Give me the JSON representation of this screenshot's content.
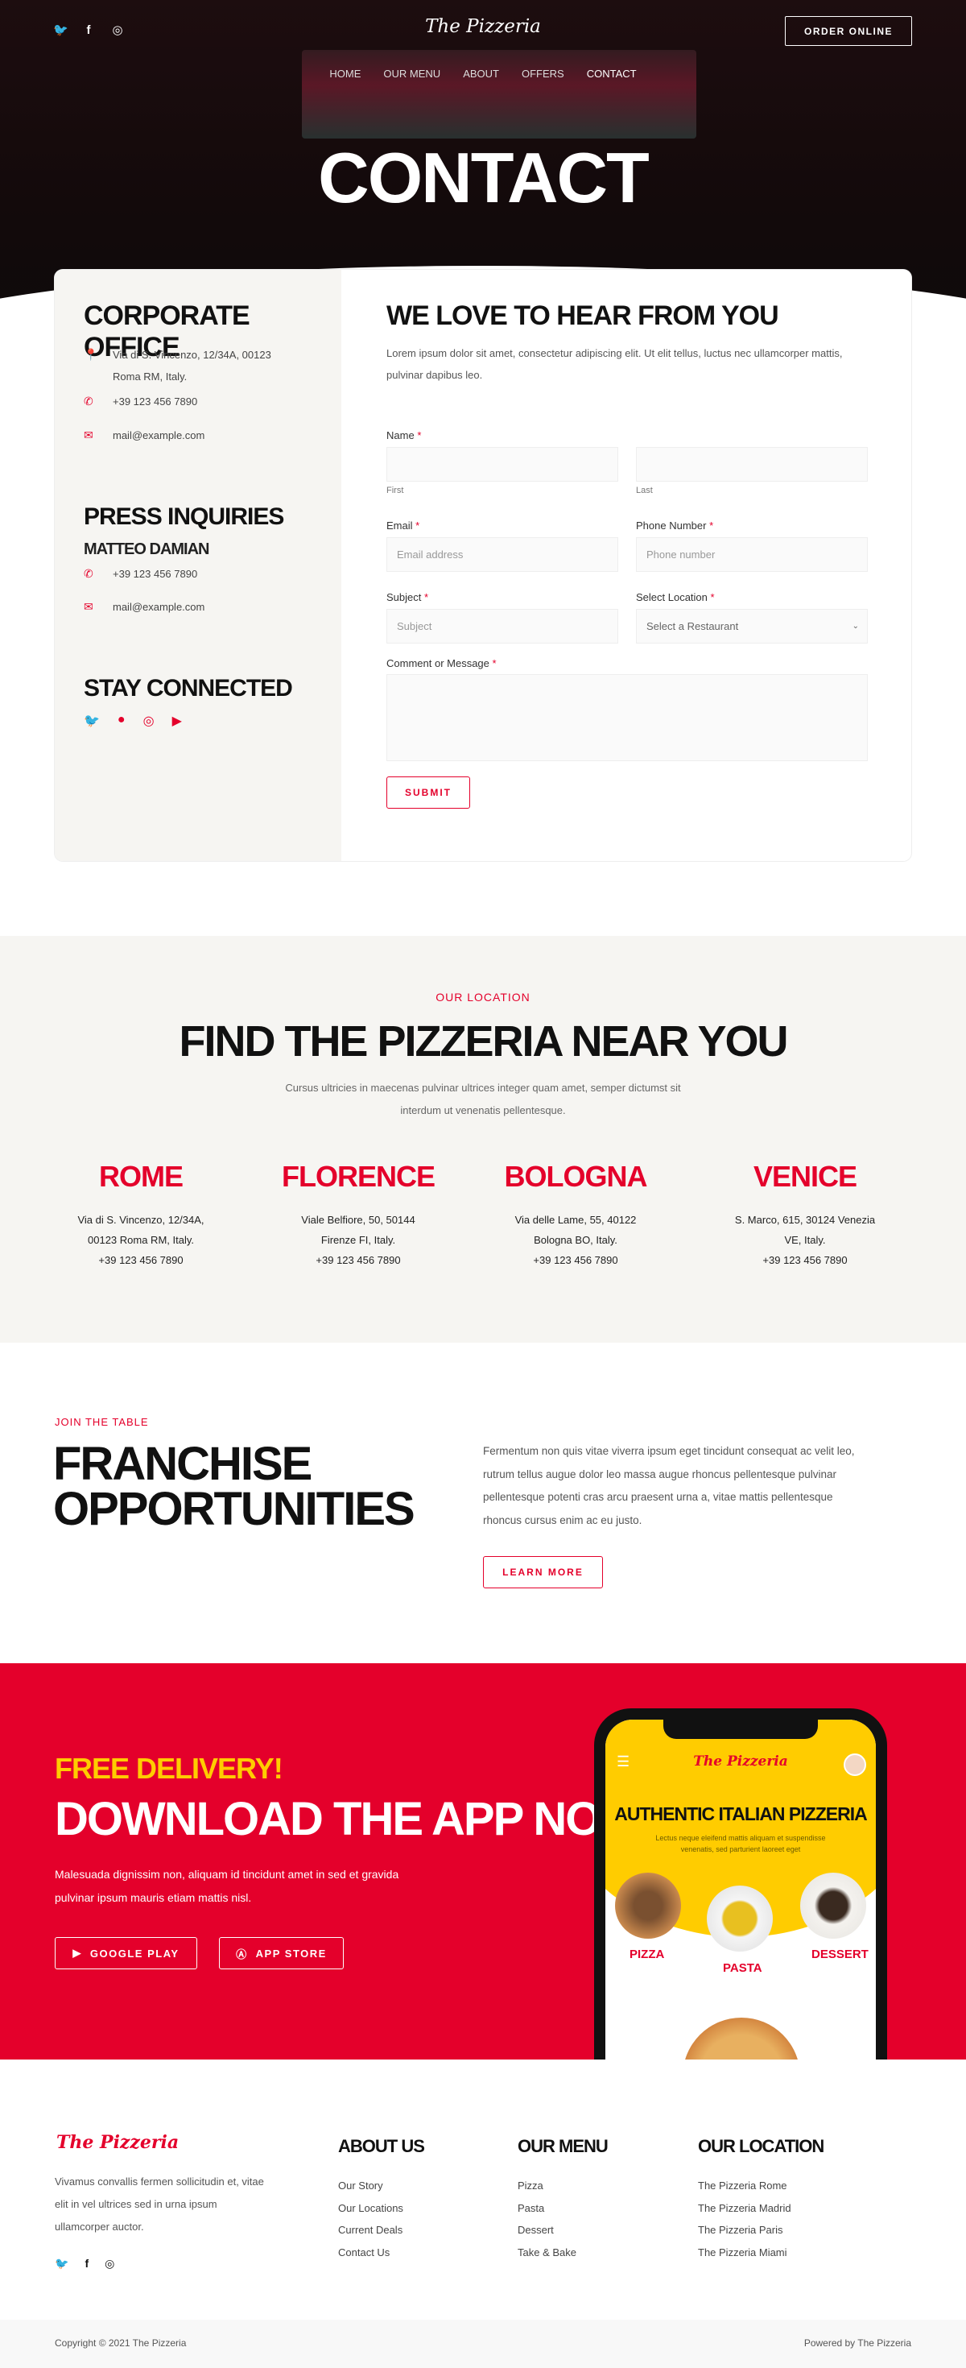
{
  "colors": {
    "accent": "#e4002b",
    "yellow": "#ffcc00",
    "panel": "#f6f5f2"
  },
  "header": {
    "brand": "The Pizzeria",
    "order_button": "ORDER ONLINE",
    "social_icons": [
      "twitter-icon",
      "facebook-icon",
      "instagram-icon"
    ],
    "nav": [
      {
        "label": "HOME",
        "active": false
      },
      {
        "label": "OUR MENU",
        "active": false
      },
      {
        "label": "ABOUT",
        "active": false
      },
      {
        "label": "OFFERS",
        "active": false
      },
      {
        "label": "CONTACT",
        "active": true
      }
    ],
    "title": "CONTACT"
  },
  "contact": {
    "corporate": {
      "title": "CORPORATE OFFICE",
      "address_line1": "Via di S. Vincenzo, 12/34A, 00123",
      "address_line2": "Roma RM, Italy.",
      "phone": "+39 123 456 7890",
      "email": "mail@example.com"
    },
    "press": {
      "title": "PRESS INQUIRIES",
      "name": "MATTEO DAMIAN",
      "phone": "+39 123 456 7890",
      "email": "mail@example.com"
    },
    "stay": {
      "title": "STAY CONNECTED",
      "icons": [
        "twitter-icon",
        "facebook-icon",
        "instagram-icon",
        "youtube-icon"
      ]
    },
    "form": {
      "title": "WE LOVE TO HEAR FROM YOU",
      "intro": "Lorem ipsum dolor sit amet, consectetur adipiscing elit. Ut elit tellus, luctus nec ullamcorper mattis, pulvinar dapibus leo.",
      "name_label": "Name",
      "first": "First",
      "last": "Last",
      "email_label": "Email",
      "email_placeholder": "Email address",
      "phone_label": "Phone Number",
      "phone_placeholder": "Phone number",
      "subject_label": "Subject",
      "subject_placeholder": "Subject",
      "location_label": "Select Location",
      "location_value": "Select a Restaurant",
      "message_label": "Comment or Message",
      "required": "*",
      "submit": "SUBMIT"
    }
  },
  "locations": {
    "eyebrow": "OUR LOCATION",
    "title": "FIND THE PIZZERIA NEAR YOU",
    "text": "Cursus ultricies in maecenas pulvinar ultrices integer quam amet, semper dictumst sit interdum ut venenatis pellentesque.",
    "cities": [
      {
        "name": "ROME",
        "line1": "Via di S. Vincenzo, 12/34A,",
        "line2": "00123 Roma RM, Italy.",
        "phone": "+39 123 456 7890"
      },
      {
        "name": "FLORENCE",
        "line1": "Viale Belfiore, 50, 50144",
        "line2": "Firenze FI, Italy.",
        "phone": "+39 123 456 7890"
      },
      {
        "name": "BOLOGNA",
        "line1": "Via delle Lame, 55, 40122",
        "line2": "Bologna BO, Italy.",
        "phone": "+39 123 456 7890"
      },
      {
        "name": "VENICE",
        "line1": "S. Marco, 615, 30124 Venezia",
        "line2": "VE, Italy.",
        "phone": "+39 123 456 7890"
      }
    ]
  },
  "franchise": {
    "eyebrow": "JOIN THE TABLE",
    "title1": "FRANCHISE",
    "title2": "OPPORTUNITIES",
    "text": "Fermentum non quis vitae viverra ipsum eget tincidunt consequat ac velit leo, rutrum tellus augue dolor leo massa augue rhoncus pellentesque pulvinar pellentesque potenti cras arcu praesent urna a, vitae mattis pellentesque rhoncus cursus enim ac eu justo.",
    "button": "LEARN MORE"
  },
  "app": {
    "eyebrow": "FREE DELIVERY!",
    "title": "DOWNLOAD THE APP NOW!",
    "text": "Malesuada dignissim non, aliquam id tincidunt amet in sed et gravida pulvinar ipsum mauris etiam mattis nisl.",
    "google": "GOOGLE PLAY",
    "apple": "APP STORE",
    "phone": {
      "brand": "The Pizzeria",
      "title": "AUTHENTIC ITALIAN PIZZERIA",
      "text": "Lectus neque eleifend mattis aliquam et suspendisse venenatis, sed parturient laoreet eget",
      "cats": [
        "PIZZA",
        "PASTA",
        "DESSERT"
      ]
    }
  },
  "footer": {
    "brand": "The Pizzeria",
    "text": "Vivamus convallis fermen sollicitudin et, vitae elit in vel ultrices sed in urna ipsum ullamcorper auctor.",
    "about": {
      "title": "ABOUT US",
      "links": [
        "Our Story",
        "Our Locations",
        "Current Deals",
        "Contact Us"
      ]
    },
    "menu": {
      "title": "OUR MENU",
      "links": [
        "Pizza",
        "Pasta",
        "Dessert",
        "Take & Bake"
      ]
    },
    "location": {
      "title": "OUR LOCATION",
      "links": [
        "The Pizzeria Rome",
        "The Pizzeria Madrid",
        "The Pizzeria Paris",
        "The Pizzeria Miami"
      ]
    },
    "copyright": "Copyright © 2021 The Pizzeria",
    "powered": "Powered by The Pizzeria"
  }
}
